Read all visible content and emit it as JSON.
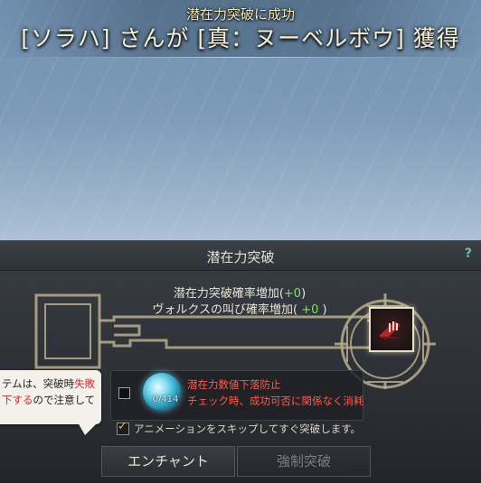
{
  "banner": {
    "subtitle": "潜在力突破に成功",
    "title": "[ソラハ] さんが [真：ヌーベルボウ] 獲得"
  },
  "dialog": {
    "title": "潜在力突破",
    "help": "?",
    "rate_line1_label": "潜在力突破確率増加(",
    "rate_line1_value": "+0",
    "rate_line1_suffix": ")",
    "rate_line2_label": "ヴォルクスの叫び確率増加( ",
    "rate_line2_value": "+0",
    "rate_line2_suffix": " )"
  },
  "tooltip": {
    "line1_a": "テムは、突破時",
    "line1_b": "失敗",
    "line2_a": "下する",
    "line2_b": "ので注意して"
  },
  "stone": {
    "count": "0/414",
    "line1": "潜在力数値下落防止",
    "line2": "チェック時、成功可否に関係なく消耗"
  },
  "skip": {
    "label": "アニメーションをスキップしてすぐ突破します。",
    "checked": true
  },
  "buttons": {
    "enchant": "エンチャント",
    "force": "強制突破"
  }
}
